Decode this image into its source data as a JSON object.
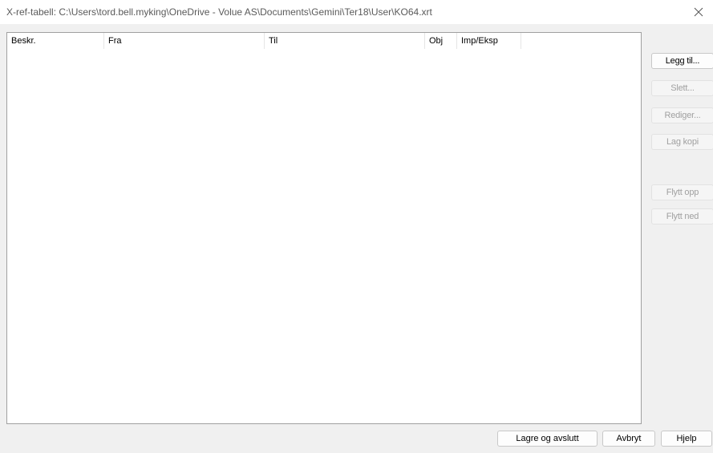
{
  "window": {
    "title": "X-ref-tabell:  C:\\Users\\tord.bell.myking\\OneDrive - Volue AS\\Documents\\Gemini\\Ter18\\User\\KO64.xrt",
    "close_icon": "close-icon"
  },
  "table": {
    "columns": [
      "Beskr.",
      "Fra",
      "Til",
      "Obj",
      "Imp/Eksp"
    ],
    "rows": []
  },
  "side_buttons": {
    "add": "Legg til...",
    "delete": "Slett...",
    "edit": "Rediger...",
    "copy": "Lag kopi",
    "move_up": "Flytt opp",
    "move_down": "Flytt ned"
  },
  "bottom_buttons": {
    "save": "Lagre og avslutt",
    "cancel": "Avbryt",
    "help": "Hjelp"
  }
}
